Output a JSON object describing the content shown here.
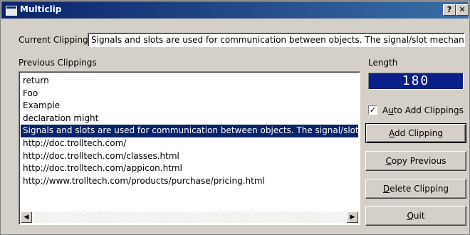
{
  "window": {
    "title": "Multiclip",
    "help_button": "?",
    "close_button": "✕"
  },
  "current_clipping": {
    "label": "Current Clipping",
    "value": "Signals and slots are used for communication between objects. The signal/slot mechanism is"
  },
  "previous": {
    "label": "Previous Clippings",
    "items": [
      "return",
      "Foo",
      "Example",
      "declaration might",
      "Signals and slots are used for communication between objects. The signal/slot mechanism is",
      "http://doc.trolltech.com/",
      "http://doc.trolltech.com/classes.html",
      "http://doc.trolltech.com/appicon.html",
      "http://www.trolltech.com/products/purchase/pricing.html"
    ],
    "selected_index": 4
  },
  "length": {
    "label": "Length",
    "value": "180"
  },
  "auto_add": {
    "pre": "A",
    "access": "u",
    "post": "to Add Clippings",
    "checked": true,
    "check_glyph": "✓"
  },
  "buttons": {
    "add": {
      "access": "A",
      "rest": "dd Clipping"
    },
    "copy": {
      "access": "C",
      "rest": "opy Previous"
    },
    "delete": {
      "access": "D",
      "rest": "elete Clipping"
    },
    "quit": {
      "access": "Q",
      "rest": "uit"
    }
  },
  "scroll": {
    "left_glyph": "◀",
    "right_glyph": "▶"
  },
  "colors": {
    "titlebar": "#0a246a",
    "selection": "#0a246a",
    "lcd": "#0a1f8a",
    "face": "#d4d0c8"
  }
}
